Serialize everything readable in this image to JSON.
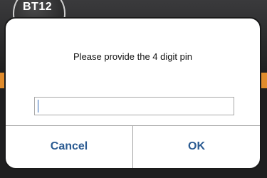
{
  "device": {
    "badge_text": "BT12"
  },
  "dialog": {
    "message": "Please provide the 4 digit pin",
    "input": {
      "value": "",
      "placeholder": ""
    },
    "buttons": {
      "cancel_label": "Cancel",
      "ok_label": "OK"
    }
  },
  "colors": {
    "accent_orange": "#e08b2c",
    "button_text": "#2b5b92",
    "dialog_bg": "#ffffff",
    "backdrop": "#1f1f20"
  }
}
